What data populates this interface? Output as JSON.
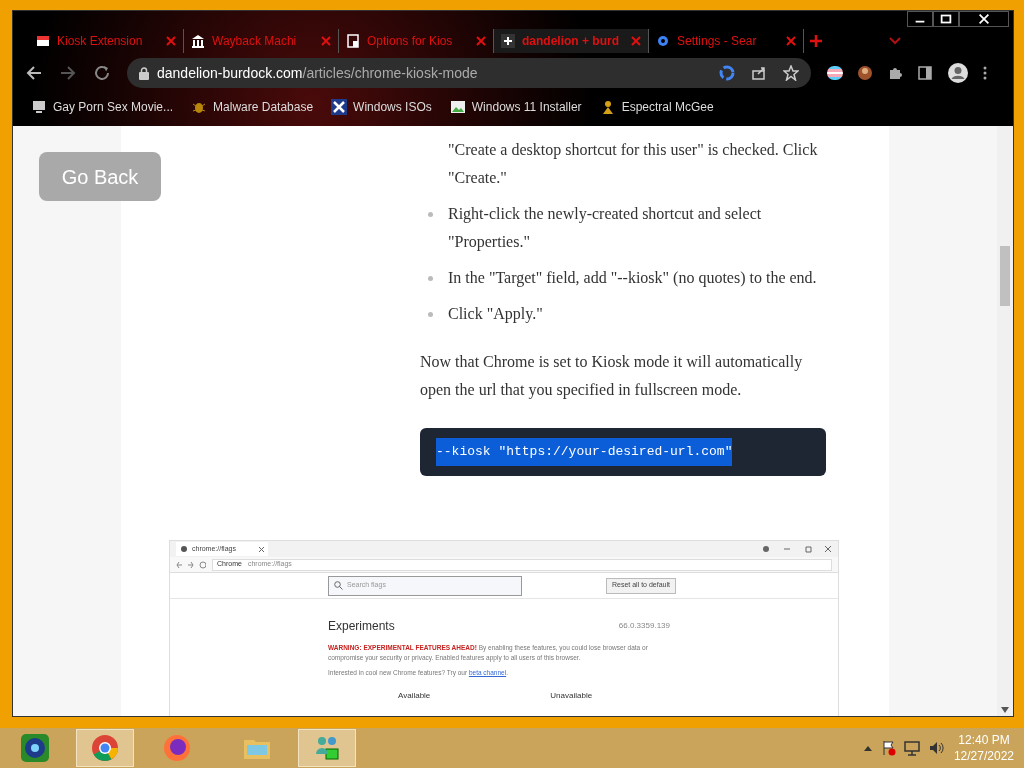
{
  "tabs": [
    {
      "label": "Kiosk Extension",
      "selected": false
    },
    {
      "label": "Wayback Machi",
      "selected": false
    },
    {
      "label": "Options for Kios",
      "selected": false
    },
    {
      "label": "dandelion + burd",
      "selected": true
    },
    {
      "label": "Settings - Sear",
      "selected": false
    }
  ],
  "address_bar": {
    "domain": "dandelion-burdock.com",
    "path": "/articles/chrome-kiosk-mode"
  },
  "bookmarks": [
    "Gay Porn Sex Movie...",
    "Malware Database",
    "Windows ISOs",
    "Windows 11 Installer",
    "Espectral McGee"
  ],
  "page": {
    "back_button": "Go Back",
    "list_items": [
      {
        "text": "\"Create a desktop shortcut for this user\" is checked. Click \"Create.\"",
        "bullet": false
      },
      {
        "text": "Right-click the newly-created shortcut and select \"Properties.\"",
        "bullet": true
      },
      {
        "text": "In the \"Target\" field, add \"--kiosk\" (no quotes) to the end.",
        "bullet": true
      },
      {
        "text": "Click \"Apply.\"",
        "bullet": true
      }
    ],
    "paragraph": "Now that Chrome is set to Kiosk mode it will automatically open the url that you specified in fullscreen mode.",
    "code": {
      "text": "--kiosk \"https://your-desired-url.com\"",
      "selected": true
    },
    "screenshot": {
      "tab_title": "chrome://flags",
      "site_chip": "Chrome",
      "url": "chrome://flags",
      "search_placeholder": "Search flags",
      "reset_button": "Reset all to default",
      "heading": "Experiments",
      "version": "66.0.3359.139",
      "warning": "WARNING: EXPERIMENTAL FEATURES AHEAD!",
      "warning_text": "By enabling these features, you could lose browser data or compromise your security or privacy. Enabled features apply to all users of this browser.",
      "interest_text": "Interested in cool new Chrome features? Try our",
      "interest_link": "beta channel",
      "interest_end": ".",
      "columns": [
        "Available",
        "Unavailable"
      ]
    }
  },
  "taskbar": {
    "apps": [
      {
        "kind": "media",
        "selected": false
      },
      {
        "kind": "chrome",
        "selected": true
      },
      {
        "kind": "firefox",
        "selected": false
      },
      {
        "kind": "explorer",
        "selected": false
      },
      {
        "kind": "network",
        "selected": true
      }
    ],
    "time": "12:40 PM",
    "date": "12/27/2022"
  }
}
